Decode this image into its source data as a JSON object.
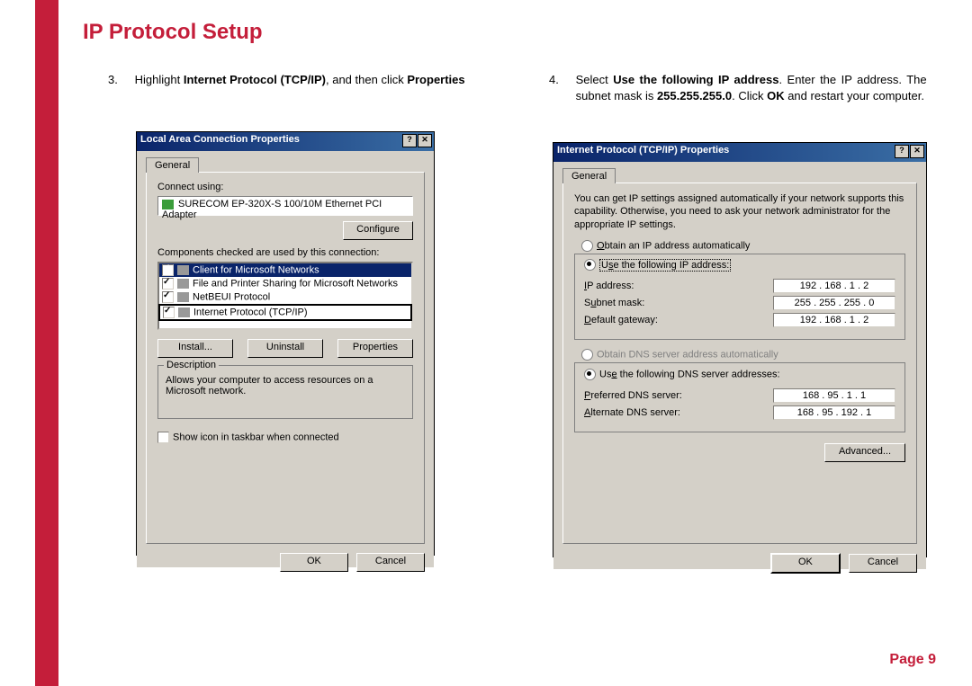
{
  "title": "IP Protocol Setup",
  "step3": {
    "num": "3.",
    "a": "Highlight ",
    "b": "Internet Protocol (TCP/IP)",
    "c": ", and then click ",
    "d": "Properties"
  },
  "step4": {
    "num": "4.",
    "a": "Select ",
    "b": "Use the following IP address",
    "c": ". Enter the IP address. The subnet mask is ",
    "d": "255.255.255.0",
    "e": ". Click ",
    "f": "OK",
    "g": " and restart your computer."
  },
  "dlg1": {
    "title": "Local Area Connection Properties",
    "tab": "General",
    "connect_using": "Connect using:",
    "adapter": "SURECOM EP-320X-S 100/10M Ethernet PCI Adapter",
    "configure": "Configure",
    "components_label": "Components checked are used by this connection:",
    "items": [
      "Client for Microsoft Networks",
      "File and Printer Sharing for Microsoft Networks",
      "NetBEUI Protocol",
      "Internet Protocol (TCP/IP)"
    ],
    "install": "Install...",
    "uninstall": "Uninstall",
    "properties": "Properties",
    "desc_label": "Description",
    "desc_text": "Allows your computer to access resources on a Microsoft network.",
    "show_icon": "Show icon in taskbar when connected",
    "ok": "OK",
    "cancel": "Cancel"
  },
  "dlg2": {
    "title": "Internet Protocol (TCP/IP) Properties",
    "tab": "General",
    "info": "You can get IP settings assigned automatically if your network supports this capability. Otherwise, you need to ask your network administrator for the appropriate IP settings.",
    "r1": "Obtain an IP address automatically",
    "r2": "Use the following IP address:",
    "ip_label": "IP address:",
    "subnet_label": "Subnet mask:",
    "gateway_label": "Default gateway:",
    "ip": "192 . 168 .  1  .  2",
    "subnet": "255 . 255 . 255 .  0",
    "gateway": "192 . 168 .  1  .  2",
    "r3": "Obtain DNS server address automatically",
    "r4": "Use the following DNS server addresses:",
    "pref_label": "Preferred DNS server:",
    "alt_label": "Alternate DNS server:",
    "dns1": "168 .  95 .  1  .  1",
    "dns2": "168 .  95 . 192 .  1",
    "advanced": "Advanced...",
    "ok": "OK",
    "cancel": "Cancel"
  },
  "footer_a": "Page ",
  "footer_b": "9",
  "help": "?",
  "close": "✕"
}
